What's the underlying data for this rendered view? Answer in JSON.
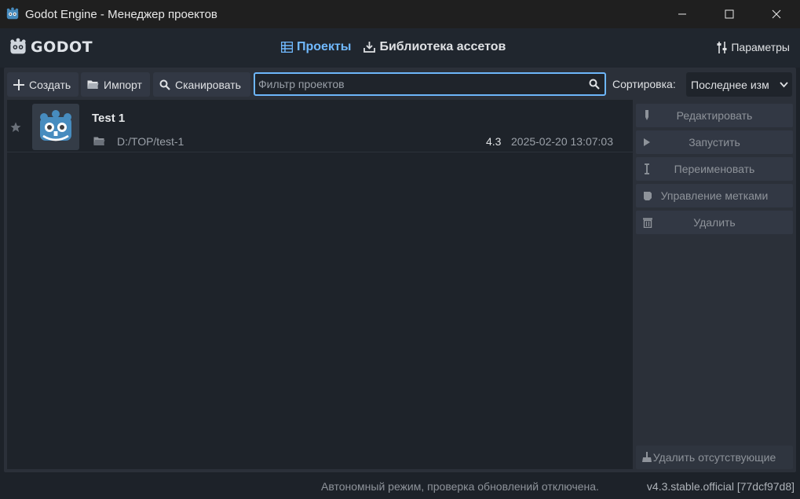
{
  "window": {
    "title": "Godot Engine - Менеджер проектов",
    "minimize_glyph": "—",
    "maximize_glyph": "☐",
    "close_glyph": "✕"
  },
  "header": {
    "logo_text": "GODOT",
    "tabs": [
      {
        "label": "Проекты",
        "icon": "projects-list-icon",
        "active": true
      },
      {
        "label": "Библиотека ассетов",
        "icon": "download-icon",
        "active": false
      }
    ],
    "settings_label": "Параметры"
  },
  "toolbar": {
    "create_label": "Создать",
    "import_label": "Импорт",
    "scan_label": "Сканировать",
    "filter_placeholder": "Фильтр проектов",
    "sort_label": "Сортировка:",
    "sort_value": "Последнее изм"
  },
  "projects": [
    {
      "name": "Test 1",
      "path": "D:/TOP/test-1",
      "version": "4.3",
      "modified": "2025-02-20 13:07:03",
      "favorite": false
    }
  ],
  "actions": {
    "edit_label": "Редактировать",
    "run_label": "Запустить",
    "rename_label": "Переименовать",
    "tags_label": "Управление метками",
    "remove_label": "Удалить",
    "remove_missing_label": "Удалить отсутствующие"
  },
  "status": {
    "message": "Автономный режим, проверка обновлений отключена.",
    "version": "v4.3.stable.official [77dcf97d8]"
  },
  "colors": {
    "accent": "#6db6fa",
    "background": "#1d2229",
    "panel": "#2b3039",
    "button": "#323844"
  }
}
